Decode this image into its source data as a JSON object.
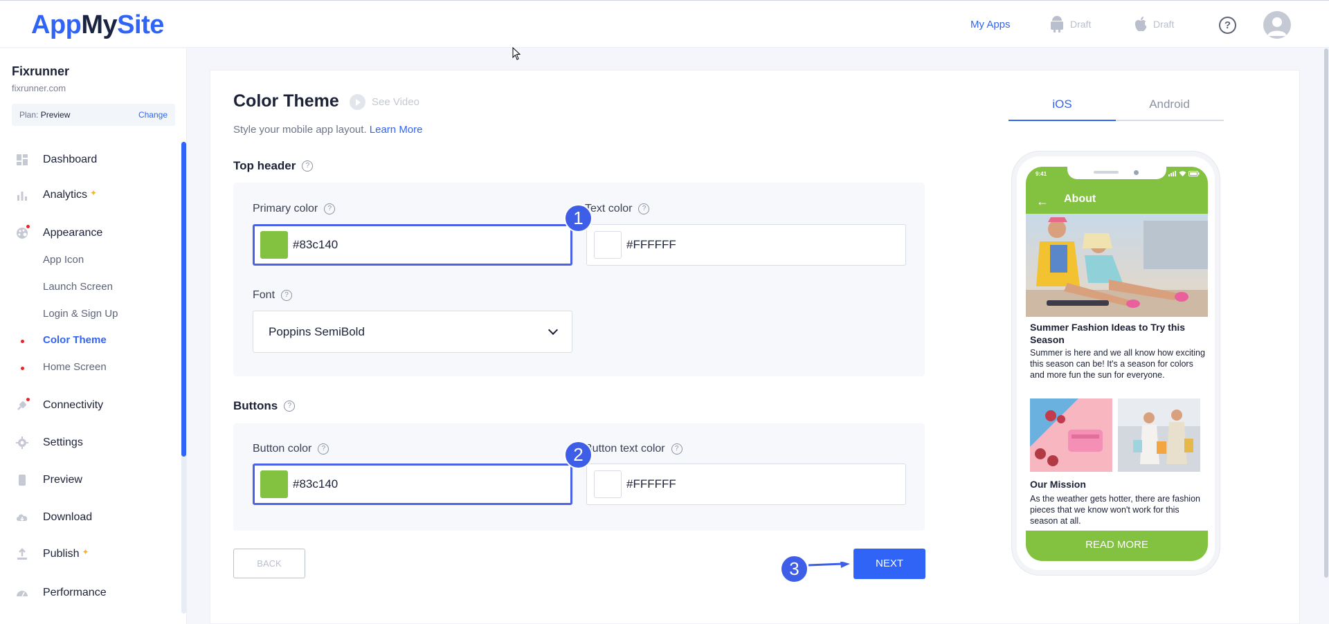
{
  "brand": {
    "logo_part1": "App",
    "logo_part2": "My",
    "logo_part3": "Site"
  },
  "topbar": {
    "my_apps": "My Apps",
    "android_status": "Draft",
    "ios_status": "Draft",
    "help": "?"
  },
  "sidebar": {
    "site_name": "Fixrunner",
    "site_url": "fixrunner.com",
    "plan_label": "Plan:",
    "plan_value": "Preview",
    "plan_change": "Change",
    "items": {
      "dashboard": "Dashboard",
      "analytics": "Analytics",
      "appearance": "Appearance",
      "app_icon": "App Icon",
      "launch_screen": "Launch Screen",
      "login_signup": "Login & Sign Up",
      "color_theme": "Color Theme",
      "home_screen": "Home Screen",
      "connectivity": "Connectivity",
      "settings": "Settings",
      "preview": "Preview",
      "download": "Download",
      "publish": "Publish",
      "performance": "Performance"
    }
  },
  "main": {
    "title": "Color Theme",
    "see_video": "See Video",
    "subtitle": "Style your mobile app layout.",
    "learn_more": "Learn More",
    "top_header": {
      "section_title": "Top header",
      "primary_color_label": "Primary color",
      "primary_color_value": "#83c140",
      "text_color_label": "Text color",
      "text_color_value": "#FFFFFF",
      "font_label": "Font",
      "font_value": "Poppins SemiBold"
    },
    "buttons": {
      "section_title": "Buttons",
      "button_color_label": "Button color",
      "button_color_value": "#83c140",
      "button_text_color_label": "Button text color",
      "button_text_color_value": "#FFFFFF"
    },
    "back_label": "BACK",
    "next_label": "NEXT",
    "badges": [
      "1",
      "2",
      "3"
    ]
  },
  "preview": {
    "tab_ios": "iOS",
    "tab_android": "Android",
    "status_time": "9:41",
    "header_title": "About",
    "post_title": "Summer Fashion Ideas to Try this Season",
    "post_body": "Summer is here and we all know how exciting this season can be! It's a season for colors and more fun the sun for everyone.",
    "mission_title": "Our Mission",
    "mission_body": "As the weather gets hotter, there are fashion pieces that we know won't work for this season at all.",
    "read_more": "READ MORE"
  },
  "colors": {
    "accent": "#3064f6",
    "primary_green": "#83c140",
    "badge": "#3f5ee8",
    "text_white": "#FFFFFF"
  }
}
